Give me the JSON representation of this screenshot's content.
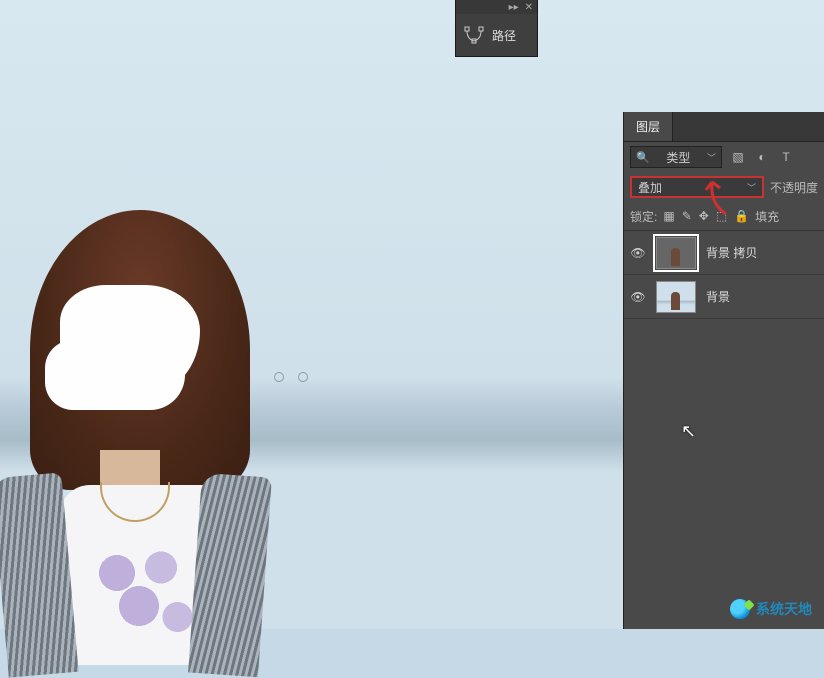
{
  "paths_panel": {
    "label": "路径"
  },
  "layers_panel": {
    "tab_label": "图层",
    "filter_label": "类型",
    "blend_mode": "叠加",
    "opacity_label": "不透明度",
    "lock_label": "锁定:",
    "fill_label": "填充",
    "layers": [
      {
        "name": "背景 拷贝",
        "visible": true,
        "selected": true
      },
      {
        "name": "背景",
        "visible": true,
        "selected": false
      }
    ]
  },
  "watermark": {
    "text": "系统天地"
  }
}
